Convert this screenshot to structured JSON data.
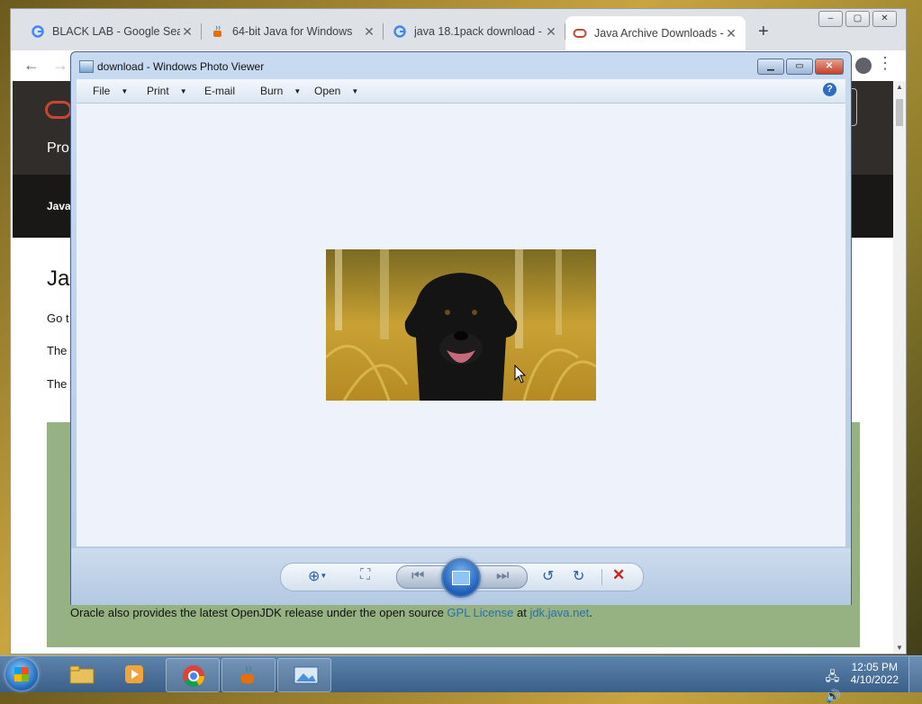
{
  "browser": {
    "tabs": [
      {
        "label": "BLACK LAB - Google Sear",
        "icon": "google-icon"
      },
      {
        "label": "64-bit Java for Windows",
        "icon": "java-icon"
      },
      {
        "label": "java 18.1pack download -",
        "icon": "google-icon"
      },
      {
        "label": "Java Archive Downloads -",
        "icon": "oracle-icon",
        "active": true
      }
    ],
    "new_tab": "+",
    "window_controls": [
      "–",
      "▢",
      "✕"
    ]
  },
  "oracle_page": {
    "header_label": "Pro",
    "nav_label": "Java",
    "heading": "Ja",
    "para1": "Go t",
    "para2": "The",
    "para3": "The",
    "green_text_pre": "Oracle also provides the latest OpenJDK release under the open source ",
    "green_link1": "GPL License",
    "green_text_mid": " at ",
    "green_link2": "jdk.java.net",
    "green_text_post": ".",
    "accent_color": "#c74634"
  },
  "photo_viewer": {
    "title": "download - Windows Photo Viewer",
    "menu": {
      "file": "File",
      "print": "Print",
      "email": "E-mail",
      "burn": "Burn",
      "open": "Open"
    },
    "help": "?",
    "controls": {
      "zoom_icon": "zoom-icon",
      "fit_icon": "actual-size-icon",
      "prev_icon": "previous-icon",
      "slideshow_icon": "slideshow-icon",
      "next_icon": "next-icon",
      "rotate_ccw_icon": "rotate-counterclockwise-icon",
      "rotate_cw_icon": "rotate-clockwise-icon",
      "delete_icon": "delete-icon"
    }
  },
  "taskbar": {
    "time": "12:05 PM",
    "date": "4/10/2022",
    "apps": [
      "file-explorer-icon",
      "media-player-icon",
      "chrome-icon",
      "java-icon",
      "photo-viewer-icon"
    ]
  }
}
